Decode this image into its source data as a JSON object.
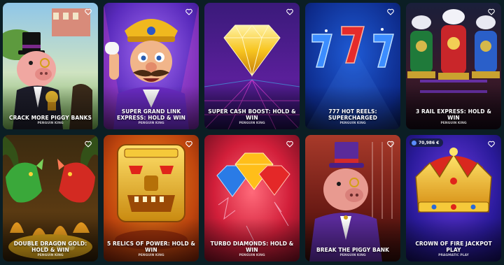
{
  "games": [
    {
      "title": "CRACK MORE PIGGY BANKS",
      "provider": "PENGUIN KING"
    },
    {
      "title": "SUPER GRAND LINK EXPRESS: HOLD & WIN",
      "provider": "PENGUIN KING"
    },
    {
      "title": "SUPER CASH BOOST: HOLD & WIN",
      "provider": "PENGUIN KING"
    },
    {
      "title": "777 HOT REELS: SUPERCHARGED",
      "provider": "PENGUIN KING"
    },
    {
      "title": "3 RAIL EXPRESS: HOLD & WIN",
      "provider": "PENGUIN KING"
    },
    {
      "title": "DOUBLE DRAGON GOLD: HOLD & WIN",
      "provider": "PENGUIN KING"
    },
    {
      "title": "5 RELICS OF POWER: HOLD & WIN",
      "provider": "PENGUIN KING"
    },
    {
      "title": "TURBO DIAMONDS: HOLD & WIN",
      "provider": "PENGUIN KING"
    },
    {
      "title": "BREAK THE PIGGY BANK",
      "provider": "PENGUIN KING"
    },
    {
      "title": "CROWN OF FIRE JACKPOT PLAY",
      "provider": "PRAGMATIC PLAY"
    }
  ],
  "jackpot_badge": {
    "amount": "70,986 €"
  },
  "icons": {
    "favorite": "heart-outline-icon",
    "jackpot": "coin-icon"
  },
  "colors": {
    "background": "#0b1e24",
    "text": "#ffffff"
  }
}
